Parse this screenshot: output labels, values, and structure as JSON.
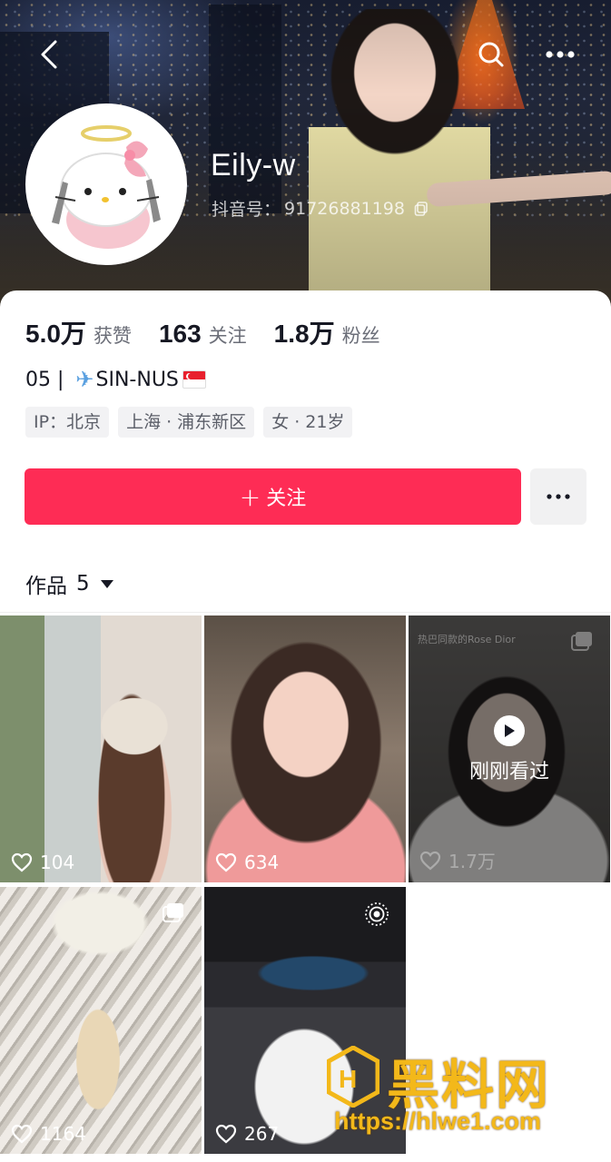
{
  "header": {
    "username": "Eily-w",
    "douyin_id_label": "抖音号：",
    "douyin_id": "91726881198",
    "icons": [
      "back-arrow-icon",
      "search-icon",
      "more-dots-icon",
      "copy-icon"
    ]
  },
  "stats": [
    {
      "value": "5.0万",
      "label": "获赞"
    },
    {
      "value": "163",
      "label": "关注"
    },
    {
      "value": "1.8万",
      "label": "粉丝"
    }
  ],
  "bio": {
    "text": "05 | ",
    "route": "SIN-NUS"
  },
  "tags": [
    "IP：北京",
    "上海 · 浦东新区",
    "女 · 21岁"
  ],
  "actions": {
    "follow_plus": "+",
    "follow_label": "关注"
  },
  "works_tab": {
    "label": "作品",
    "count": "5"
  },
  "videos": [
    {
      "likes": "104"
    },
    {
      "likes": "634"
    },
    {
      "likes": "1.7万",
      "caption": "热巴同款的Rose Dior",
      "overlay": "刚刚看过"
    },
    {
      "likes": "1164"
    },
    {
      "likes": "267"
    }
  ],
  "watermark": {
    "title": "黑料网",
    "url": "https://hlwe1.com"
  },
  "colors": {
    "accent": "#fe2c55",
    "watermark": "#f3b81a"
  }
}
